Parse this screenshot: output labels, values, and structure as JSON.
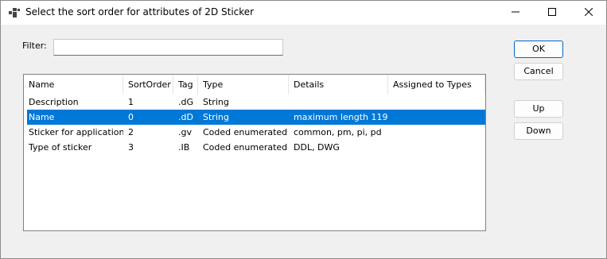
{
  "window": {
    "title": "Select the sort order for attributes of 2D Sticker"
  },
  "filter": {
    "label": "Filter:",
    "value": ""
  },
  "table": {
    "columns": [
      "Name",
      "SortOrder",
      "Tag",
      "Type",
      "Details",
      "Assigned to Types"
    ],
    "rows": [
      {
        "name": "Description",
        "sort_order": "1",
        "tag": ".dG",
        "type": "String",
        "details": "",
        "assigned": "",
        "selected": false
      },
      {
        "name": "Name",
        "sort_order": "0",
        "tag": ".dD",
        "type": "String",
        "details": "maximum length 119",
        "assigned": "",
        "selected": true
      },
      {
        "name": "Sticker for application",
        "sort_order": "2",
        "tag": ".gv",
        "type": "Coded enumerated",
        "details": "common, pm, pi, pd",
        "assigned": "",
        "selected": false
      },
      {
        "name": "Type of sticker",
        "sort_order": "3",
        "tag": ".IB",
        "type": "Coded enumerated",
        "details": "DDL, DWG",
        "assigned": "",
        "selected": false
      }
    ]
  },
  "buttons": {
    "ok": "OK",
    "cancel": "Cancel",
    "up": "Up",
    "down": "Down"
  },
  "colors": {
    "selection": "#0078d7",
    "default_button_border": "#0067c0"
  }
}
